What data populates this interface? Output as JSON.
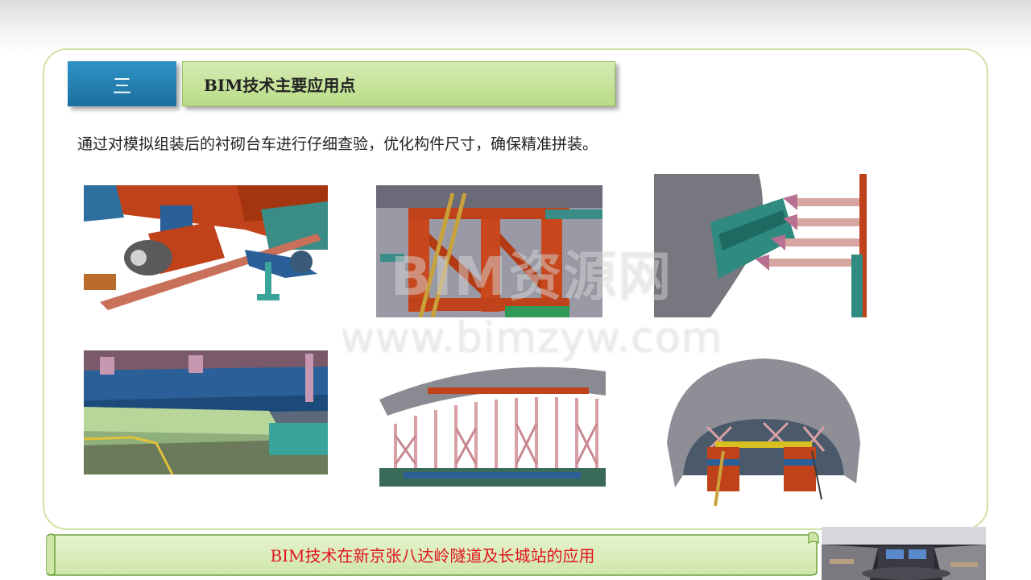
{
  "section": {
    "number": "三",
    "title": "BIM技术主要应用点"
  },
  "description": "通过对模拟组装后的衬砌台车进行仔细查验，优化构件尺寸，确保精准拼装。",
  "watermark": {
    "line1": "BIM资源网",
    "line2": "www.bimzyw.com"
  },
  "footer": {
    "banner_text": "BIM技术在新京张八达岭隧道及长城站的应用"
  },
  "images": [
    {
      "name": "trolley-wheel-detail"
    },
    {
      "name": "frame-ladder-detail"
    },
    {
      "name": "hydraulic-jacks-detail"
    },
    {
      "name": "beam-structure-detail"
    },
    {
      "name": "arch-formwork-side-view"
    },
    {
      "name": "arch-formwork-front-view"
    }
  ],
  "colors": {
    "accent_blue": "#2680b5",
    "accent_green": "#c6e39b",
    "banner_text": "#e0141e",
    "frame_border": "#cfe3a6"
  }
}
